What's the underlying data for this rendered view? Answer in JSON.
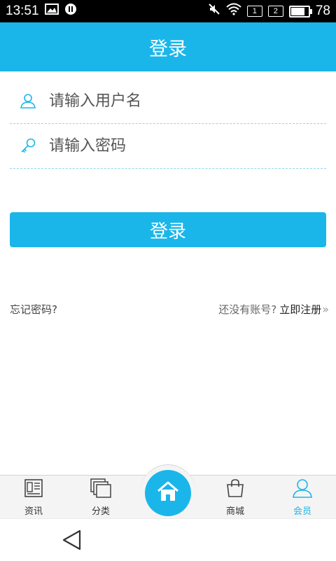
{
  "status_bar": {
    "time": "13:51",
    "sim1": "1",
    "sim2": "2",
    "battery_level": "78",
    "battery_fraction": 0.78,
    "icons": [
      "image-icon",
      "pause-icon",
      "mute-icon",
      "wifi-icon",
      "battery-icon"
    ]
  },
  "header": {
    "title": "登录"
  },
  "login_form": {
    "username_placeholder": "请输入用户名",
    "password_placeholder": "请输入密码",
    "submit_label": "登录"
  },
  "links": {
    "forgot_password": "忘记密码?",
    "no_account": "还没有账号?",
    "register": "立即注册",
    "register_chevron": "»"
  },
  "bottom_nav": {
    "items": [
      {
        "label": "资讯",
        "icon": "news-icon"
      },
      {
        "label": "分类",
        "icon": "category-icon"
      },
      {
        "label": "",
        "icon": "home-icon"
      },
      {
        "label": "商城",
        "icon": "shopping-bag-icon"
      },
      {
        "label": "会员",
        "icon": "member-icon",
        "active": true
      }
    ]
  },
  "colors": {
    "accent": "#1ab6ea",
    "divider": "#8fd6ea",
    "nav_background": "#f4f4f4"
  }
}
